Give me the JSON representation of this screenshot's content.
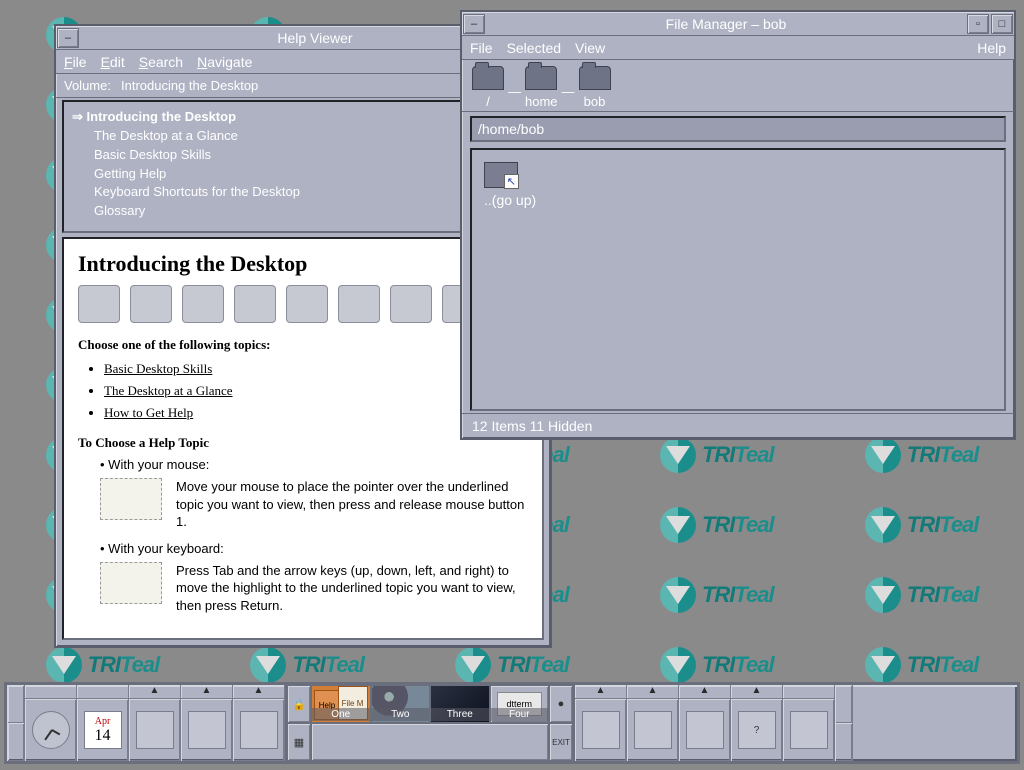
{
  "wallpaper_brand": "TRITeal",
  "help": {
    "title": "Help Viewer",
    "menu": [
      "File",
      "Edit",
      "Search",
      "Navigate"
    ],
    "volume_label": "Volume:",
    "volume_value": "Introducing the Desktop",
    "toc": {
      "current": "Introducing the Desktop",
      "items": [
        "The Desktop at a Glance",
        "Basic Desktop Skills",
        "Getting Help",
        "Keyboard Shortcuts for the Desktop",
        "Glossary"
      ]
    },
    "body": {
      "heading": "Introducing the Desktop",
      "choose_prompt": "Choose one of the following topics:",
      "links": [
        "Basic Desktop Skills",
        "The Desktop at a Glance",
        "How to Get Help"
      ],
      "choose_topic_heading": "To Choose a Help Topic",
      "mouse_label": "With your mouse:",
      "mouse_text": "Move your mouse to place the pointer over the underlined topic you want to view, then press and release mouse button 1.",
      "keyboard_label": "With your keyboard:",
      "keyboard_text": "Press Tab and the arrow keys (up, down, left, and right) to move the highlight to the underlined topic you want to view, then press Return."
    }
  },
  "fm": {
    "title": "File Manager – bob",
    "menu": [
      "File",
      "Selected",
      "View"
    ],
    "menu_right": "Help",
    "path_segments": [
      "/",
      "home",
      "bob"
    ],
    "path_text": "/home/bob",
    "entries": {
      "goup": "..(go up)"
    },
    "status": "12 Items 11 Hidden"
  },
  "panel": {
    "date_month": "Apr",
    "date_day": "14",
    "exit_label": "EXIT",
    "ws": [
      "One",
      "Two",
      "Three",
      "Four"
    ],
    "ws1_win_a": "Help",
    "ws1_win_b": "File M",
    "ws4_term": "dtterm",
    "icons_left": [
      "clock",
      "calendar",
      "filemgr",
      "textedit",
      "mail"
    ],
    "icons_right": [
      "printer",
      "style",
      "appmgr",
      "help",
      "trash"
    ]
  }
}
